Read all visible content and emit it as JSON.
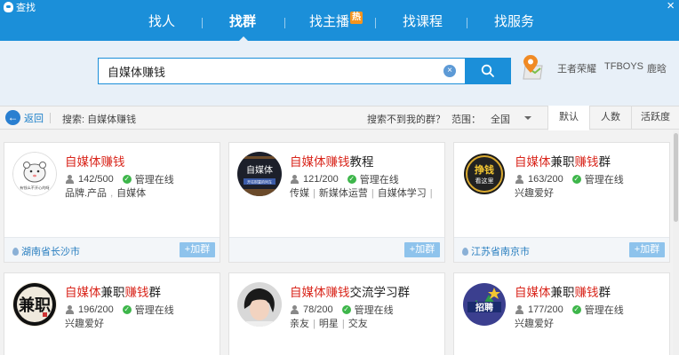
{
  "window": {
    "title": "查找",
    "close_icon": "×"
  },
  "nav": {
    "items": [
      "找人",
      "找群",
      "找主播",
      "找课程",
      "找服务"
    ],
    "active": "找群",
    "hot_badge": "热"
  },
  "search": {
    "value": "自媒体赚钱",
    "clear_icon": "×"
  },
  "hot_words": [
    "王者荣耀",
    "TFBOYS",
    "鹿晗"
  ],
  "toolbar": {
    "back_label": "返回",
    "back_icon": "←",
    "query_label": "搜索: 自媒体赚钱",
    "not_found": "搜索不到我的群？",
    "range_label": "范围：",
    "range_value": "全国",
    "sort_tabs": [
      "默认",
      "人数",
      "活跃度"
    ],
    "active_sort": "默认"
  },
  "join_label": "+加群",
  "online_label": "管理在线",
  "cards": [
    {
      "name_parts": [
        {
          "t": "自媒体赚钱",
          "hl": true
        }
      ],
      "members": "142/500",
      "tags": [
        "品牌.产品",
        "自媒体"
      ],
      "location": "湖南省长沙市"
    },
    {
      "name_parts": [
        {
          "t": "自媒体赚钱",
          "hl": true
        },
        {
          "t": "教程",
          "hl": false
        }
      ],
      "members": "121/200",
      "tags": [
        "传媒",
        "新媒体运营",
        "自媒体学习"
      ],
      "location": ""
    },
    {
      "name_parts": [
        {
          "t": "自媒体",
          "hl": true
        },
        {
          "t": "兼职",
          "hl": false
        },
        {
          "t": "赚钱",
          "hl": true
        },
        {
          "t": "群",
          "hl": false
        }
      ],
      "members": "163/200",
      "tags": [
        "兴趣爱好"
      ],
      "location": "江苏省南京市"
    },
    {
      "name_parts": [
        {
          "t": "自媒体",
          "hl": true
        },
        {
          "t": "兼职",
          "hl": false
        },
        {
          "t": "赚钱",
          "hl": true
        },
        {
          "t": "群",
          "hl": false
        }
      ],
      "members": "196/200",
      "tags": [
        "兴趣爱好"
      ],
      "location": ""
    },
    {
      "name_parts": [
        {
          "t": "自媒体赚钱",
          "hl": true
        },
        {
          "t": "交流学习群",
          "hl": false
        }
      ],
      "members": "78/200",
      "tags": [
        "亲友",
        "明星",
        "交友"
      ],
      "location": ""
    },
    {
      "name_parts": [
        {
          "t": "自媒体",
          "hl": true
        },
        {
          "t": "兼职",
          "hl": false
        },
        {
          "t": "赚钱",
          "hl": true
        },
        {
          "t": "群",
          "hl": false
        }
      ],
      "members": "177/200",
      "tags": [
        "兴趣爱好"
      ],
      "location": ""
    }
  ],
  "avatars": [
    {
      "icon": "hamster-icon",
      "caption": "有钱么不开心的呀"
    },
    {
      "icon": "media-banner-icon",
      "caption": "自媒体",
      "subcaption": "开往财富的列车"
    },
    {
      "icon": "coin-badge-icon",
      "caption": "挣钱",
      "subcaption": "看这里"
    },
    {
      "icon": "ink-character-icon",
      "caption": "兼职"
    },
    {
      "icon": "portrait-icon"
    },
    {
      "icon": "recruit-banner-icon",
      "caption": "招聘"
    }
  ],
  "colors": {
    "accent": "#1b8fd9",
    "highlight": "#d9261c",
    "online": "#3db64a",
    "join": "#8ec3ec"
  }
}
